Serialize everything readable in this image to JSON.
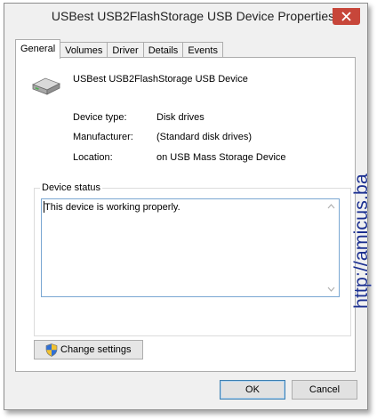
{
  "window": {
    "title": "USBest USB2FlashStorage USB Device Properties"
  },
  "tabs": [
    {
      "label": "General",
      "active": true
    },
    {
      "label": "Volumes",
      "active": false
    },
    {
      "label": "Driver",
      "active": false
    },
    {
      "label": "Details",
      "active": false
    },
    {
      "label": "Events",
      "active": false
    }
  ],
  "device": {
    "icon": "disk-drive-icon",
    "name": "USBest USB2FlashStorage USB Device",
    "properties": [
      {
        "label": "Device type:",
        "value": "Disk drives"
      },
      {
        "label": "Manufacturer:",
        "value": "(Standard disk drives)"
      },
      {
        "label": "Location:",
        "value": "on USB Mass Storage Device"
      }
    ]
  },
  "status": {
    "group_label": "Device status",
    "text": "This device is working properly."
  },
  "buttons": {
    "change_settings": "Change settings",
    "ok": "OK",
    "cancel": "Cancel"
  },
  "watermark": "http://amicus.ba",
  "colors": {
    "close_button": "#c7463a",
    "watermark": "#1b2f8f",
    "focus_border": "#7aa7d2"
  }
}
